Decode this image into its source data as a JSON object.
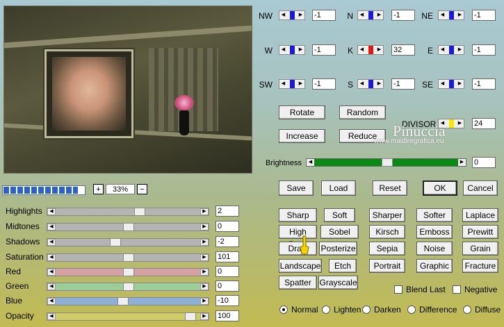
{
  "preview": {
    "zoom": "33%",
    "zoom_plus": "+",
    "zoom_minus": "−",
    "progress": 0.92
  },
  "sliders": [
    {
      "label": "Highlights",
      "value": "2",
      "pos": 0.58,
      "color": "#b4b4b4"
    },
    {
      "label": "Midtones",
      "value": "0",
      "pos": 0.5,
      "color": "#b4b4b4"
    },
    {
      "label": "Shadows",
      "value": "-2",
      "pos": 0.4,
      "color": "#b4b4b4"
    },
    {
      "label": "Saturation",
      "value": "101",
      "pos": 0.5,
      "color": "#b4b4b4"
    },
    {
      "label": "Red",
      "value": "0",
      "pos": 0.5,
      "color": "#d4a2a2"
    },
    {
      "label": "Green",
      "value": "0",
      "pos": 0.5,
      "color": "#9ccc9a"
    },
    {
      "label": "Blue",
      "value": "-10",
      "pos": 0.46,
      "color": "#8fb0d6"
    },
    {
      "label": "Opacity",
      "value": "100",
      "pos": 0.96,
      "color": "#d0cc64"
    }
  ],
  "matrix": [
    {
      "label": "NW",
      "value": "-1",
      "thumb": "#1a1adc"
    },
    {
      "label": "N",
      "value": "-1",
      "thumb": "#1a1adc"
    },
    {
      "label": "NE",
      "value": "-1",
      "thumb": "#1a1adc"
    },
    {
      "label": "W",
      "value": "-1",
      "thumb": "#1a1adc"
    },
    {
      "label": "K",
      "value": "32",
      "thumb": "#e01818"
    },
    {
      "label": "E",
      "value": "-1",
      "thumb": "#1a1adc"
    },
    {
      "label": "SW",
      "value": "-1",
      "thumb": "#1a1adc"
    },
    {
      "label": "S",
      "value": "-1",
      "thumb": "#1a1adc"
    },
    {
      "label": "SE",
      "value": "-1",
      "thumb": "#1a1adc"
    }
  ],
  "buttons": {
    "rotate": "Rotate",
    "random": "Random",
    "increase": "Increase",
    "reduce": "Reduce",
    "save": "Save",
    "load": "Load",
    "reset": "Reset",
    "ok": "OK",
    "cancel": "Cancel"
  },
  "divisor": {
    "label": "DIVISOR",
    "value": "24",
    "thumb": "#f6e800"
  },
  "brightness": {
    "label": "Brightness",
    "value": "0",
    "pos": 0.5
  },
  "presets": [
    [
      "Sharp",
      "Soft",
      "Sharper",
      "Softer",
      "Laplace"
    ],
    [
      "High Pass",
      "Sobel",
      "Kirsch",
      "Emboss",
      "Prewitt"
    ],
    [
      "Draw",
      "Posterize",
      "Sepia",
      "Noise",
      "Grain"
    ],
    [
      "Landscape",
      "Etch",
      "Portrait",
      "Graphic",
      "Fracture"
    ],
    [
      "Spatter",
      "Grayscale"
    ]
  ],
  "options": {
    "blend_last": "Blend Last",
    "negative": "Negative"
  },
  "modes": [
    "Normal",
    "Lighten",
    "Darken",
    "Difference",
    "Diffuse"
  ],
  "selected_mode": "Normal",
  "watermark": {
    "title": "Pinuccia",
    "url": "www.maidiregrafica.eu"
  }
}
